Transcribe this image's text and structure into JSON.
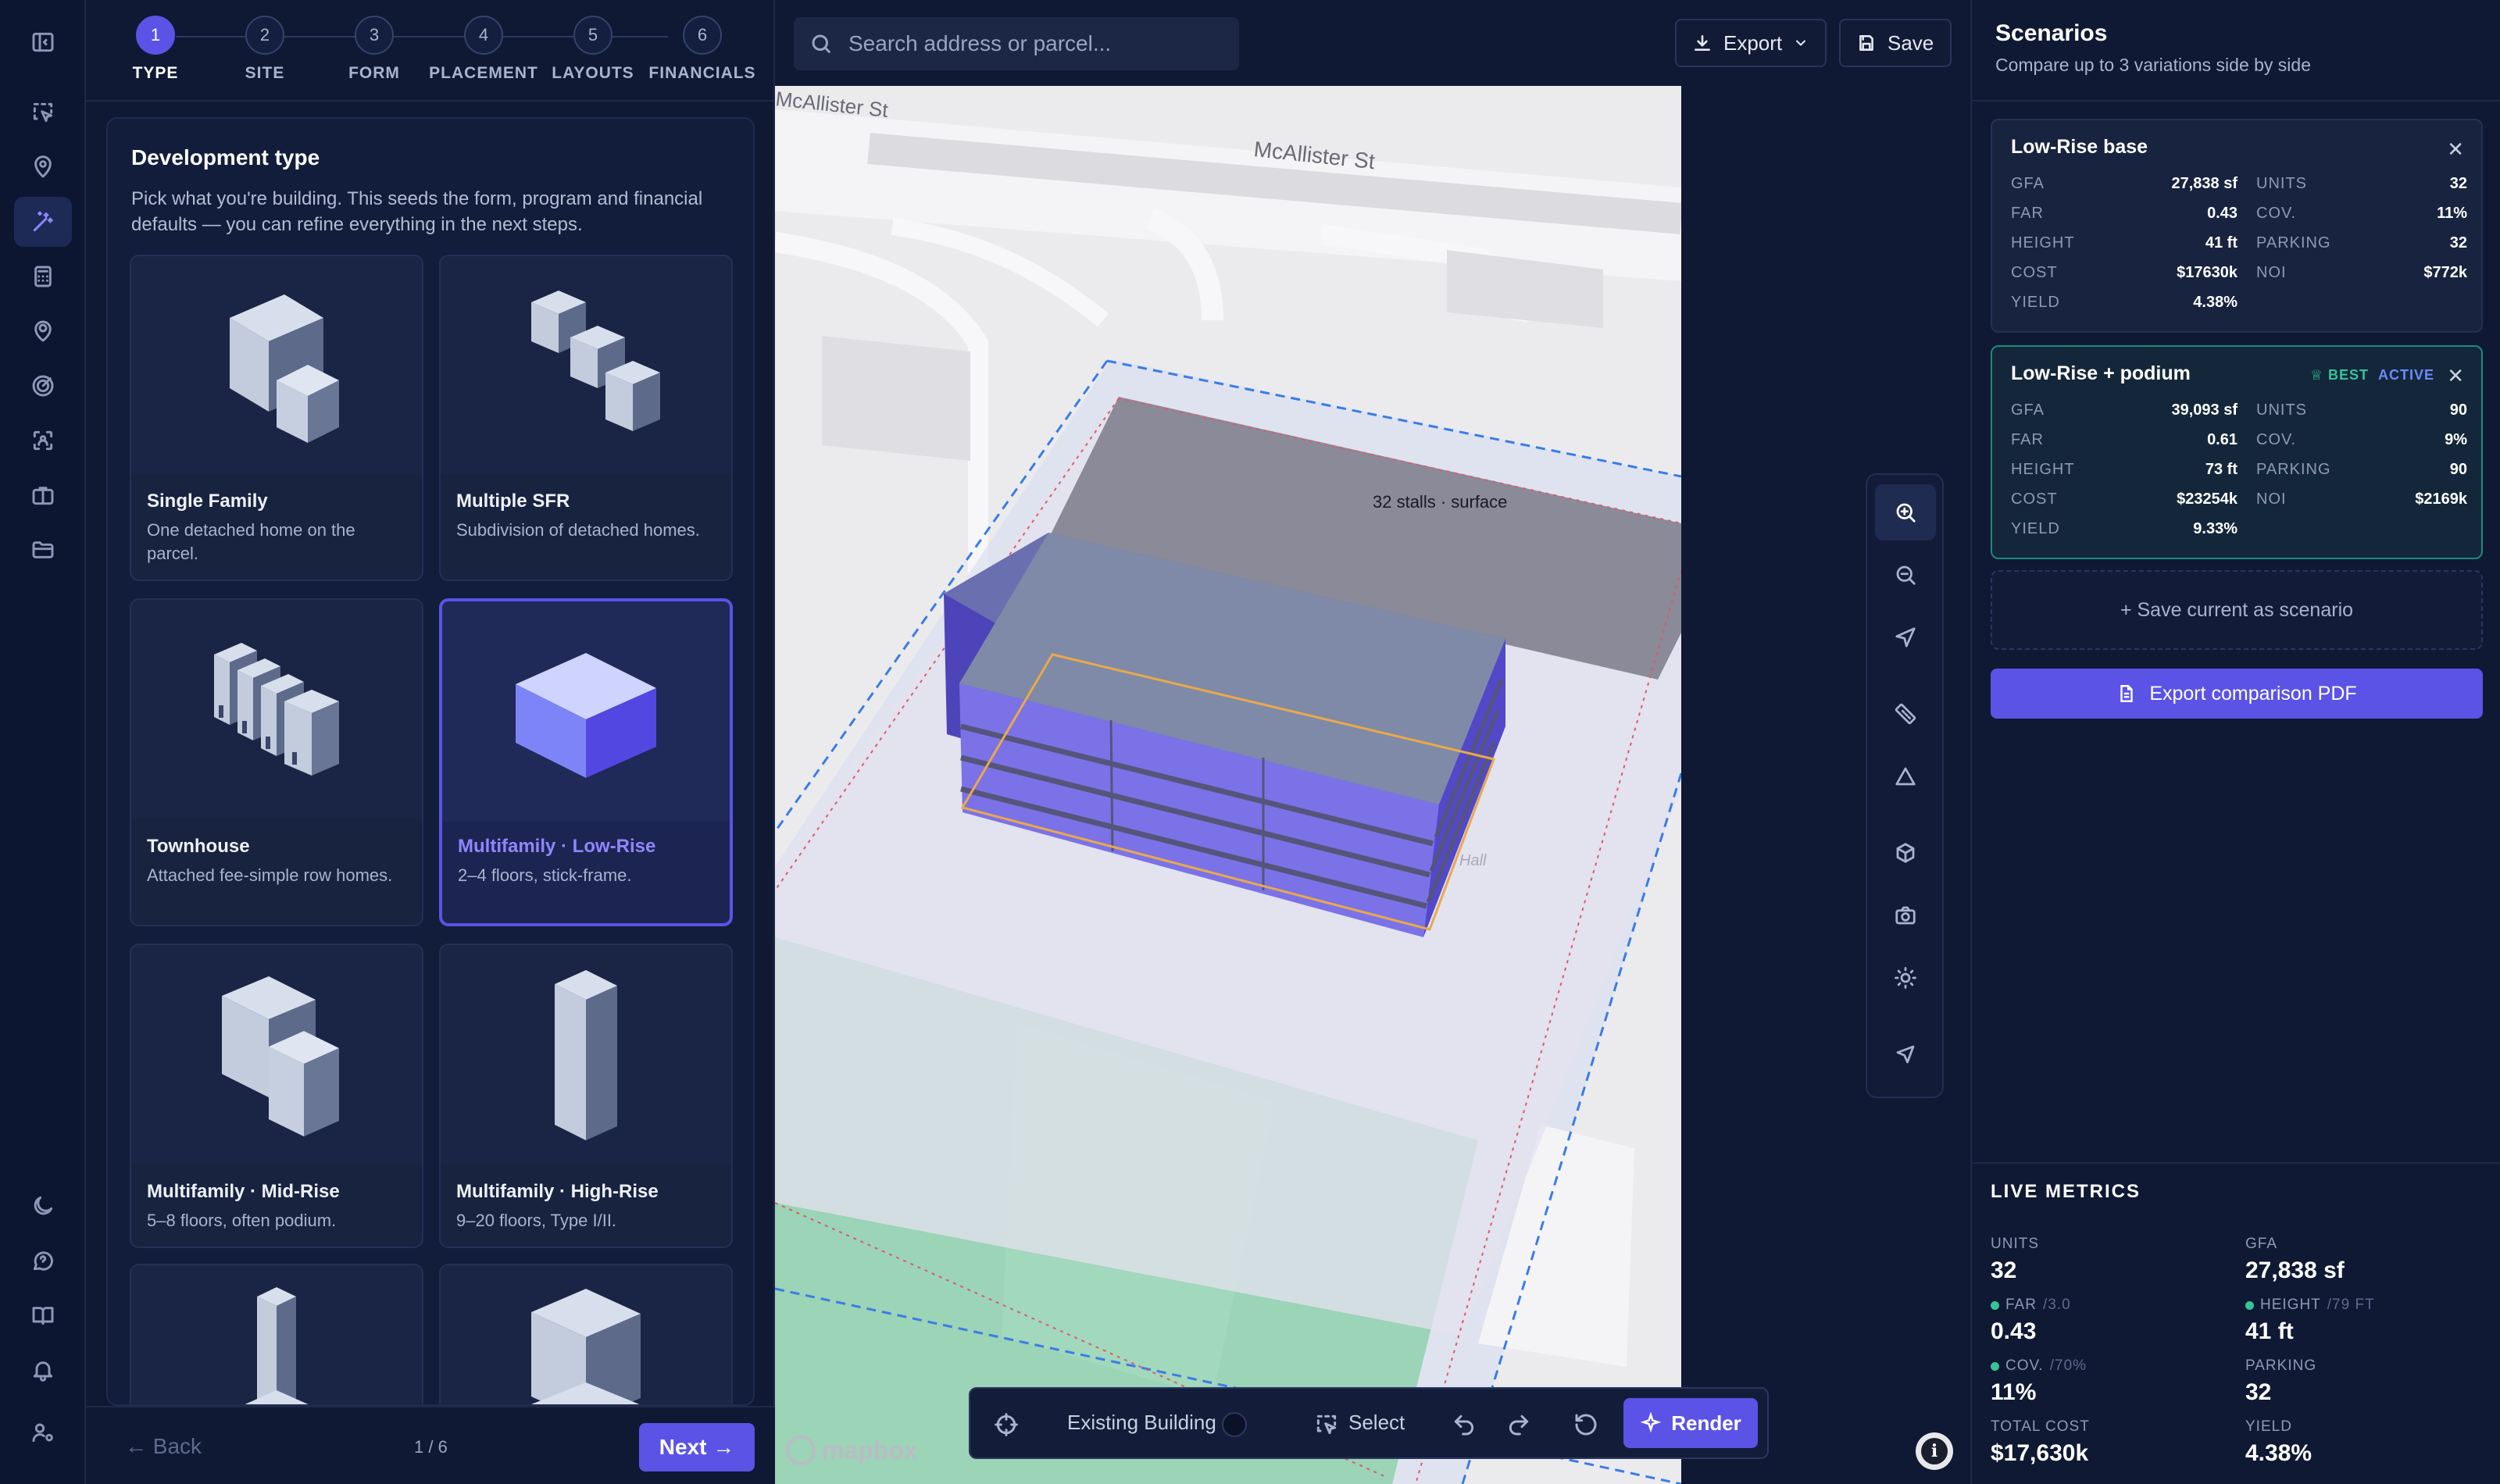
{
  "stepper": {
    "steps": [
      {
        "num": "1",
        "label": "TYPE"
      },
      {
        "num": "2",
        "label": "SITE"
      },
      {
        "num": "3",
        "label": "FORM"
      },
      {
        "num": "4",
        "label": "PLACEMENT"
      },
      {
        "num": "5",
        "label": "LAYOUTS"
      },
      {
        "num": "6",
        "label": "FINANCIALS"
      }
    ]
  },
  "dev": {
    "title": "Development type",
    "description": "Pick what you're building. This seeds the form, program and financial defaults — you can refine everything in the next steps.",
    "tiles": [
      {
        "name": "Single Family",
        "sub": "One detached home on the parcel."
      },
      {
        "name": "Multiple SFR",
        "sub": "Subdivision of detached homes."
      },
      {
        "name": "Townhouse",
        "sub": "Attached fee-simple row homes."
      },
      {
        "name": "Multifamily · Low-Rise",
        "sub": "2–4 floors, stick-frame."
      },
      {
        "name": "Multifamily · Mid-Rise",
        "sub": "5–8 floors, often podium."
      },
      {
        "name": "Multifamily · High-Rise",
        "sub": "9–20 floors, Type I/II."
      }
    ]
  },
  "footer": {
    "back": "← Back",
    "page": "1 / 6",
    "next": "Next →"
  },
  "search": {
    "placeholder": "Search address or parcel..."
  },
  "top": {
    "export": "Export",
    "save": "Save"
  },
  "map": {
    "street1": "McAllister St",
    "street2": "McAllister St",
    "stalls": "32 stalls · surface",
    "hall": "Hall",
    "logo": "mapbox"
  },
  "toolbar": {
    "existing": "Existing Building",
    "select": "Select",
    "render": "Render"
  },
  "scenarios": {
    "title": "Scenarios",
    "subtitle": "Compare up to 3 variations side by side",
    "cards": [
      {
        "name": "Low-Rise base",
        "left": [
          [
            "GFA",
            "27,838 sf"
          ],
          [
            "FAR",
            "0.43"
          ],
          [
            "HEIGHT",
            "41 ft"
          ],
          [
            "COST",
            "$17630k"
          ],
          [
            "YIELD",
            "4.38%"
          ]
        ],
        "right": [
          [
            "UNITS",
            "32"
          ],
          [
            "COV.",
            "11%"
          ],
          [
            "PARKING",
            "32"
          ],
          [
            "NOI",
            "$772k"
          ]
        ]
      },
      {
        "name": "Low-Rise + podium",
        "best": "BEST",
        "active": "ACTIVE",
        "left": [
          [
            "GFA",
            "39,093 sf"
          ],
          [
            "FAR",
            "0.61"
          ],
          [
            "HEIGHT",
            "73 ft"
          ],
          [
            "COST",
            "$23254k"
          ],
          [
            "YIELD",
            "9.33%"
          ]
        ],
        "right": [
          [
            "UNITS",
            "90"
          ],
          [
            "COV.",
            "9%"
          ],
          [
            "PARKING",
            "90"
          ],
          [
            "NOI",
            "$2169k"
          ]
        ]
      }
    ],
    "save_current": "+ Save current as scenario",
    "export_pdf": "Export comparison PDF"
  },
  "live": {
    "title": "LIVE METRICS",
    "metrics": [
      {
        "label": "UNITS",
        "limit": "",
        "value": "32",
        "dot": false
      },
      {
        "label": "GFA",
        "limit": "",
        "value": "27,838 sf",
        "dot": false
      },
      {
        "label": "FAR",
        "limit": "/3.0",
        "value": "0.43",
        "dot": true
      },
      {
        "label": "HEIGHT",
        "limit": "/79 FT",
        "value": "41 ft",
        "dot": true
      },
      {
        "label": "COV.",
        "limit": "/70%",
        "value": "11%",
        "dot": true
      },
      {
        "label": "PARKING",
        "limit": "",
        "value": "32",
        "dot": false
      },
      {
        "label": "TOTAL COST",
        "limit": "",
        "value": "$17,630k",
        "dot": false
      },
      {
        "label": "YIELD",
        "limit": "",
        "value": "4.38%",
        "dot": false
      }
    ]
  },
  "colors": {
    "accent": "#5b53e6",
    "best": "#36c39a",
    "active": "#6d8aff",
    "building": "#7b72e8",
    "roof": "#7d8bb0"
  }
}
